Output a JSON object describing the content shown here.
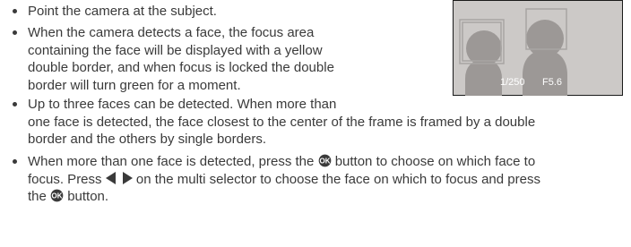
{
  "bullets": [
    {
      "lines": [
        "Point the camera at the subject."
      ]
    },
    {
      "lines": [
        "When the camera detects a face, the focus area",
        "containing the face will be displayed with a yellow",
        "double border, and when focus is locked the double",
        "border will turn green for a moment."
      ]
    },
    {
      "lines": [
        "Up to three faces can be detected. When more than",
        "one face is detected, the face closest to the center of the frame is framed by a double",
        "border and the others by single borders."
      ]
    },
    {
      "line1_before": "When more than one face is detected, press the ",
      "button_icon": "ok-button-icon",
      "line1_after": " button to choose on which face to",
      "line2_before": "focus. Press ",
      "arrows_icon": "left-right-arrows-icon",
      "line2_after": " on the multi selector to choose the face on which to focus and press",
      "line3_before": "the ",
      "line3_after": " button."
    }
  ],
  "illustration": {
    "shutter_speed": "1/250",
    "aperture": "F5.6",
    "colors": {
      "background": "#ccc9c7",
      "face": "#9c9896",
      "frame": "#a8a5a3",
      "border": "#1a1a1a",
      "text": "#ffffff"
    }
  }
}
